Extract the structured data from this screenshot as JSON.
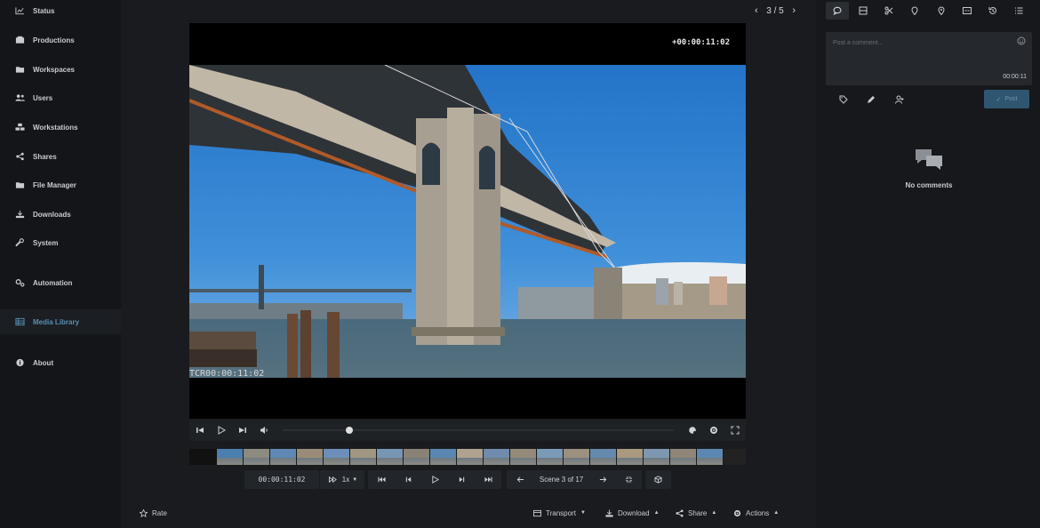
{
  "sidebar": {
    "items": [
      {
        "label": "Status",
        "icon": "chart-icon"
      },
      {
        "label": "Productions",
        "icon": "productions-icon"
      },
      {
        "label": "Workspaces",
        "icon": "folder-icon"
      },
      {
        "label": "Users",
        "icon": "users-icon"
      },
      {
        "label": "Workstations",
        "icon": "workstations-icon"
      },
      {
        "label": "Shares",
        "icon": "share-icon"
      },
      {
        "label": "File Manager",
        "icon": "folder-icon"
      },
      {
        "label": "Downloads",
        "icon": "download-icon"
      },
      {
        "label": "System",
        "icon": "wrench-icon"
      },
      {
        "label": "Automation",
        "icon": "gears-icon"
      },
      {
        "label": "Media Library",
        "icon": "media-library-icon",
        "active": true
      },
      {
        "label": "About",
        "icon": "info-icon"
      }
    ]
  },
  "pager": {
    "text": "3 / 5"
  },
  "video": {
    "timecode_overlay": "+00:00:11:02",
    "tcr_overlay": "TCR00:00:11:02",
    "progress": 0.17
  },
  "transport": {
    "timecode": "00:00:11:02",
    "rate": "1x",
    "scene_label": "Scene 3 of 17"
  },
  "bottom": {
    "rate_label": "Rate",
    "transport_label": "Transport",
    "download_label": "Download",
    "share_label": "Share",
    "actions_label": "Actions"
  },
  "comments": {
    "placeholder": "Post a comment...",
    "timestamp": "00:00:11",
    "post_label": "Post",
    "empty_label": "No comments"
  },
  "colors": {
    "accent": "#5a8fb4",
    "post_button": "#2f5670"
  }
}
